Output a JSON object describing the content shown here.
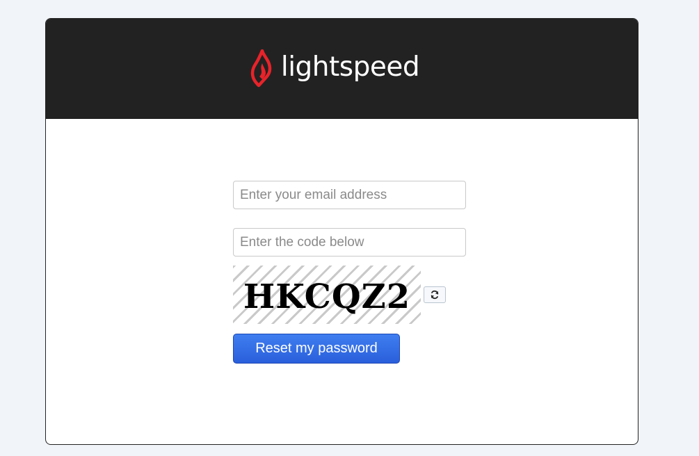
{
  "brand": {
    "name": "lightspeed",
    "logo_icon": "flame-icon",
    "accent_color": "#e8232a",
    "header_bg": "#222222"
  },
  "form": {
    "email_placeholder": "Enter your email address",
    "email_value": "",
    "code_placeholder": "Enter the code below",
    "code_value": "",
    "captcha_text": "HKCQZ2",
    "refresh_icon": "refresh-icon",
    "submit_label": "Reset my password",
    "submit_color": "#3069e6"
  }
}
